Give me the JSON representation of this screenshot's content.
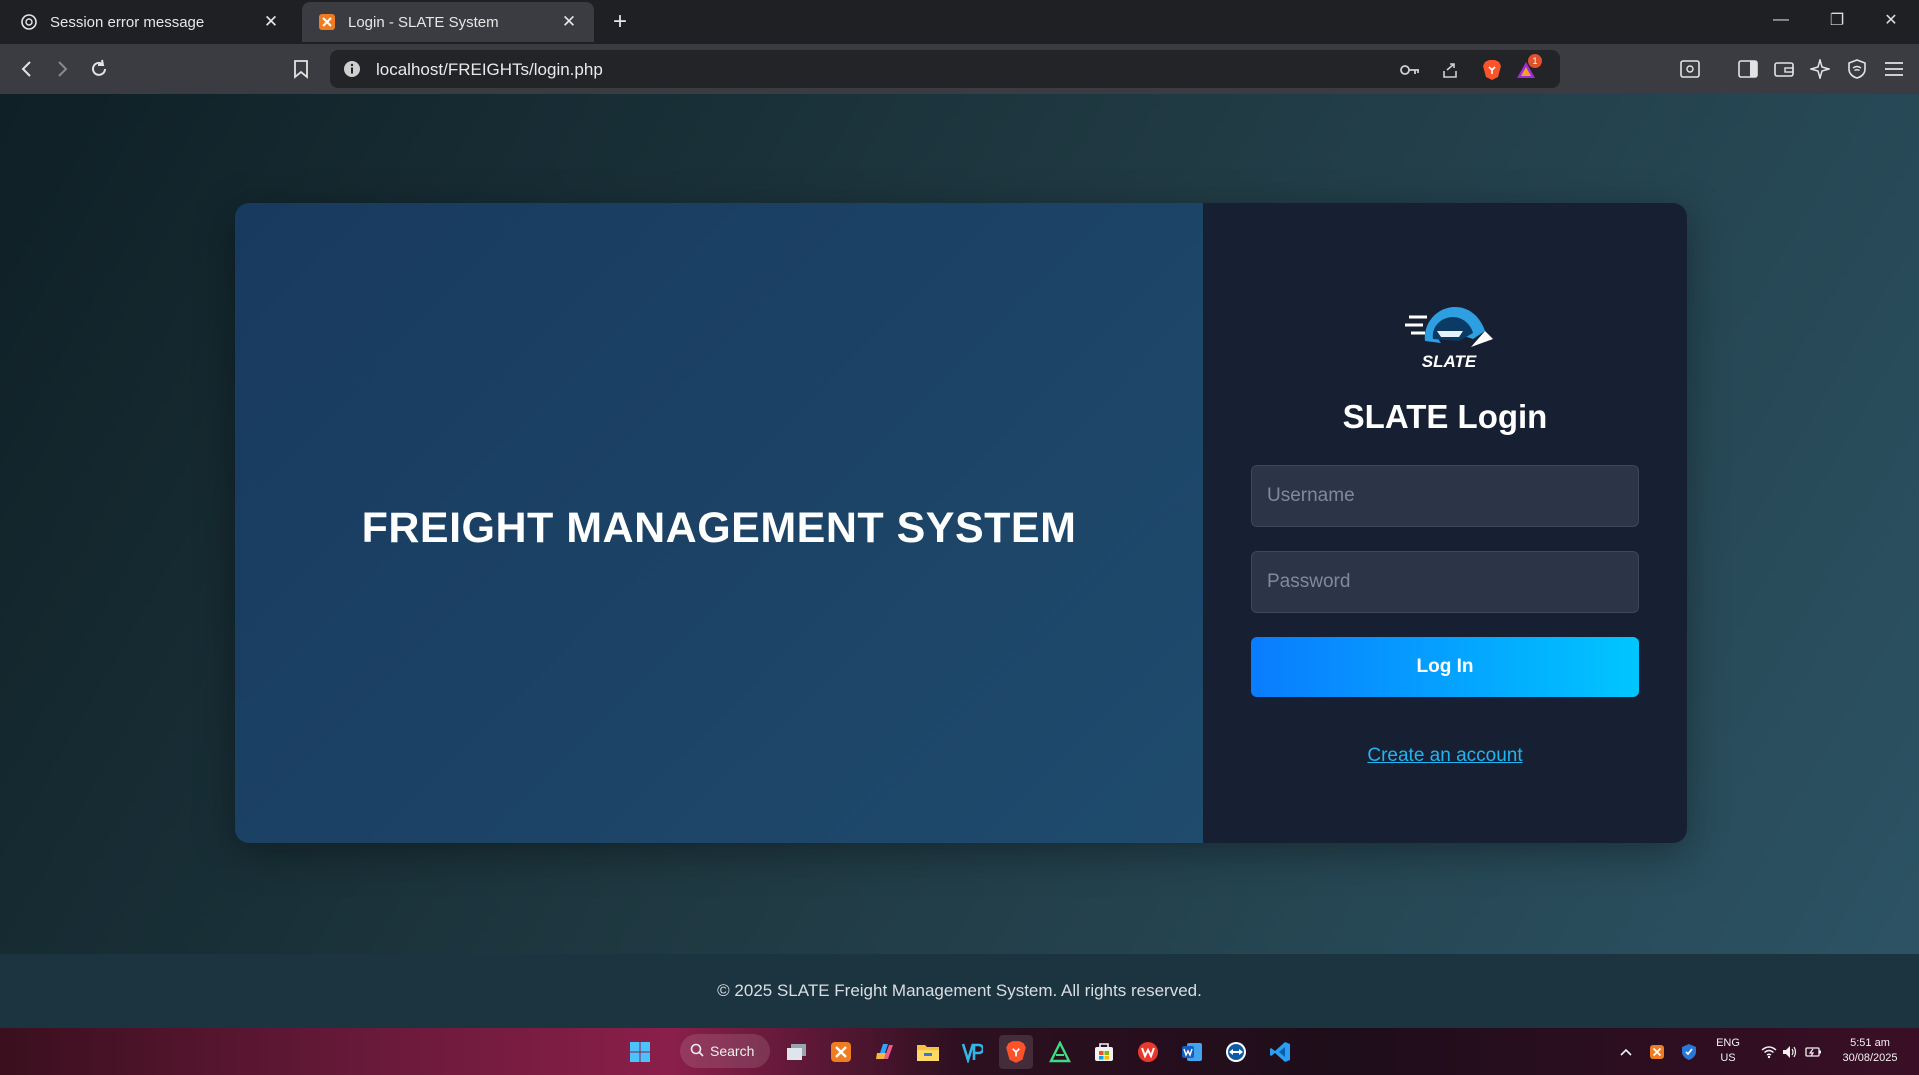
{
  "browser": {
    "tabs": [
      {
        "title": "Session error message",
        "active": false,
        "icon": "openai-icon"
      },
      {
        "title": "Login - SLATE System",
        "active": true,
        "icon": "xampp-icon"
      }
    ],
    "url": "localhost/FREIGHTs/login.php",
    "notification_count": "1"
  },
  "page": {
    "hero_title": "FREIGHT MANAGEMENT SYSTEM",
    "logo_text": "SLATE",
    "login_title": "SLATE Login",
    "username_placeholder": "Username",
    "password_placeholder": "Password",
    "login_button": "Log In",
    "create_account_link": "Create an account",
    "footer": "© 2025 SLATE Freight Management System. All rights reserved."
  },
  "taskbar": {
    "search_label": "Search",
    "language": "ENG",
    "region": "US",
    "time": "5:51 am",
    "date": "30/08/2025"
  },
  "colors": {
    "button_gradient_start": "#0a7cff",
    "button_gradient_end": "#00c6ff",
    "link": "#22b4f0",
    "panel_dark": "#172033"
  }
}
